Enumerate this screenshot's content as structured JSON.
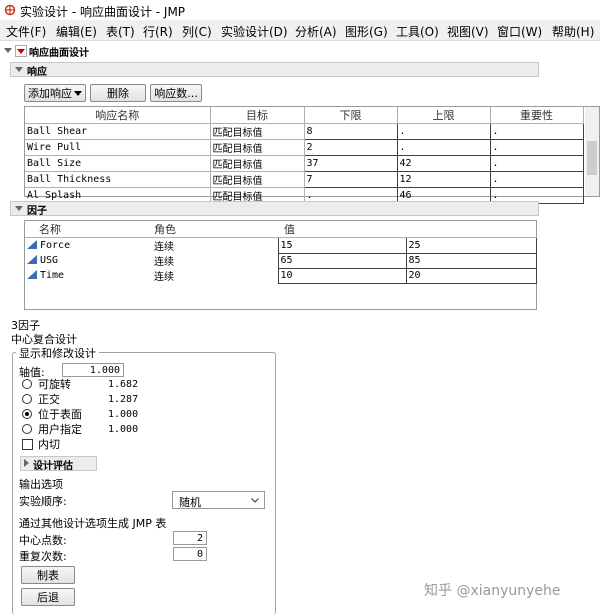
{
  "window": {
    "title": "实验设计 - 响应曲面设计 - JMP"
  },
  "menu": [
    "文件(F)",
    "编辑(E)",
    "表(T)",
    "行(R)",
    "列(C)",
    "实验设计(D)",
    "分析(A)",
    "图形(G)",
    "工具(O)",
    "视图(V)",
    "窗口(W)",
    "帮助(H)"
  ],
  "top_outline": {
    "title": "响应曲面设计"
  },
  "responses": {
    "title": "响应",
    "buttons": {
      "add": "添加响应",
      "delete": "删除",
      "num": "响应数..."
    },
    "columns": [
      "响应名称",
      "目标",
      "下限",
      "上限",
      "重要性"
    ],
    "rows": [
      {
        "name": "Ball Shear",
        "goal": "匹配目标值",
        "lower": "8",
        "upper": ".",
        "importance": "."
      },
      {
        "name": "Wire Pull",
        "goal": "匹配目标值",
        "lower": "2",
        "upper": ".",
        "importance": "."
      },
      {
        "name": "Ball Size",
        "goal": "匹配目标值",
        "lower": "37",
        "upper": "42",
        "importance": "."
      },
      {
        "name": "Ball Thickness",
        "goal": "匹配目标值",
        "lower": "7",
        "upper": "12",
        "importance": "."
      },
      {
        "name": "Al Splash",
        "goal": "匹配目标值",
        "lower": ".",
        "upper": "46",
        "importance": "."
      }
    ]
  },
  "factors": {
    "title": "因子",
    "columns": [
      "名称",
      "角色",
      "值"
    ],
    "rows": [
      {
        "name": "Force",
        "role": "连续",
        "low": "15",
        "high": "25",
        "icon": "continuous-factor-icon"
      },
      {
        "name": "USG",
        "role": "连续",
        "low": "65",
        "high": "85",
        "icon": "continuous-factor-icon"
      },
      {
        "name": "Time",
        "role": "连续",
        "low": "10",
        "high": "20",
        "icon": "continuous-factor-icon"
      }
    ]
  },
  "design": {
    "factor_count": "3因子",
    "type": "中心复合设计",
    "group_title": "显示和修改设计",
    "axial_label": "轴值:",
    "axial_value": "1.000",
    "options": [
      {
        "label": "可旋转",
        "value": "1.682",
        "selected": false
      },
      {
        "label": "正交",
        "value": "1.287",
        "selected": false
      },
      {
        "label": "位于表面",
        "value": "1.000",
        "selected": true
      },
      {
        "label": "用户指定",
        "value": "1.000",
        "selected": false
      }
    ],
    "inscribe_label": "内切",
    "evaluate_label": "设计评估",
    "output_title": "输出选项",
    "run_order_label": "实验顺序:",
    "run_order_value": "随机",
    "other_options_label": "通过其他设计选项生成 JMP 表",
    "center_points_label": "中心点数:",
    "center_points_value": "2",
    "replicates_label": "重复次数:",
    "replicates_value": "0",
    "make_table": "制表",
    "back": "后退"
  },
  "watermark": "知乎 @xianyunyehe"
}
